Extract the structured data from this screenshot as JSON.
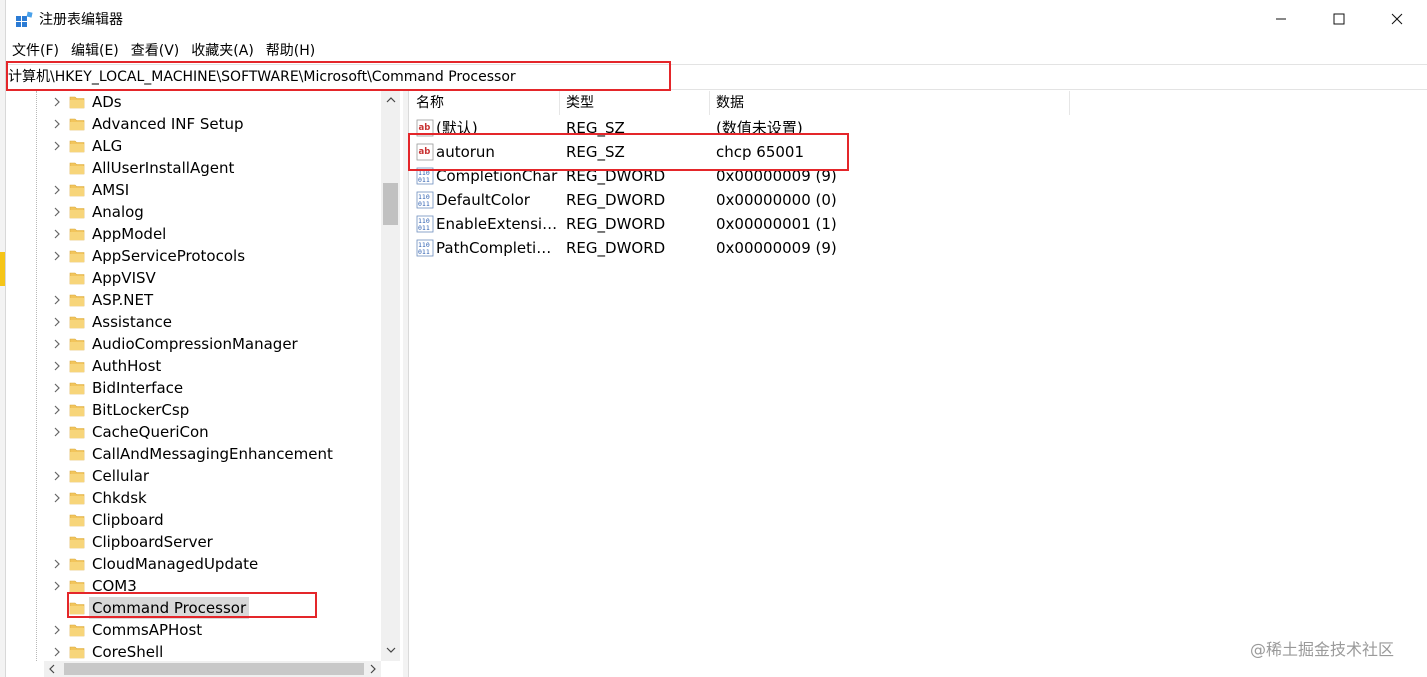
{
  "window": {
    "title": "注册表编辑器",
    "controls": {
      "minimize": "—",
      "maximize": "☐",
      "close": "✕"
    }
  },
  "menu": [
    "文件(F)",
    "编辑(E)",
    "查看(V)",
    "收藏夹(A)",
    "帮助(H)"
  ],
  "address": "计算机\\HKEY_LOCAL_MACHINE\\SOFTWARE\\Microsoft\\Command Processor",
  "tree": {
    "items": [
      {
        "label": "ADs",
        "expandable": true
      },
      {
        "label": "Advanced INF Setup",
        "expandable": true
      },
      {
        "label": "ALG",
        "expandable": true
      },
      {
        "label": "AllUserInstallAgent",
        "expandable": false
      },
      {
        "label": "AMSI",
        "expandable": true
      },
      {
        "label": "Analog",
        "expandable": true
      },
      {
        "label": "AppModel",
        "expandable": true
      },
      {
        "label": "AppServiceProtocols",
        "expandable": true
      },
      {
        "label": "AppVISV",
        "expandable": false
      },
      {
        "label": "ASP.NET",
        "expandable": true
      },
      {
        "label": "Assistance",
        "expandable": true
      },
      {
        "label": "AudioCompressionManager",
        "expandable": true
      },
      {
        "label": "AuthHost",
        "expandable": true
      },
      {
        "label": "BidInterface",
        "expandable": true
      },
      {
        "label": "BitLockerCsp",
        "expandable": true
      },
      {
        "label": "CacheQueriCon",
        "expandable": true
      },
      {
        "label": "CallAndMessagingEnhancement",
        "expandable": false
      },
      {
        "label": "Cellular",
        "expandable": true
      },
      {
        "label": "Chkdsk",
        "expandable": true
      },
      {
        "label": "Clipboard",
        "expandable": false
      },
      {
        "label": "ClipboardServer",
        "expandable": false
      },
      {
        "label": "CloudManagedUpdate",
        "expandable": true
      },
      {
        "label": "COM3",
        "expandable": true
      },
      {
        "label": "Command Processor",
        "expandable": false,
        "selected": true
      },
      {
        "label": "CommsAPHost",
        "expandable": true
      },
      {
        "label": "CoreShell",
        "expandable": true
      }
    ]
  },
  "columns": {
    "name": "名称",
    "type": "类型",
    "data": "数据"
  },
  "values": [
    {
      "name": "(默认)",
      "type": "REG_SZ",
      "data": "(数值未设置)",
      "icon": "string-value-icon"
    },
    {
      "name": "autorun",
      "type": "REG_SZ",
      "data": "chcp 65001",
      "icon": "string-value-icon"
    },
    {
      "name": "CompletionChar",
      "type": "REG_DWORD",
      "data": "0x00000009 (9)",
      "icon": "binary-value-icon"
    },
    {
      "name": "DefaultColor",
      "type": "REG_DWORD",
      "data": "0x00000000 (0)",
      "icon": "binary-value-icon"
    },
    {
      "name": "EnableExtensio...",
      "type": "REG_DWORD",
      "data": "0x00000001 (1)",
      "icon": "binary-value-icon"
    },
    {
      "name": "PathCompletio...",
      "type": "REG_DWORD",
      "data": "0x00000009 (9)",
      "icon": "binary-value-icon"
    }
  ],
  "watermark": "@稀土掘金技术社区",
  "colors": {
    "highlight": "#e4262a",
    "folder": "#f2c55c",
    "selection": "#d9d9d9"
  }
}
